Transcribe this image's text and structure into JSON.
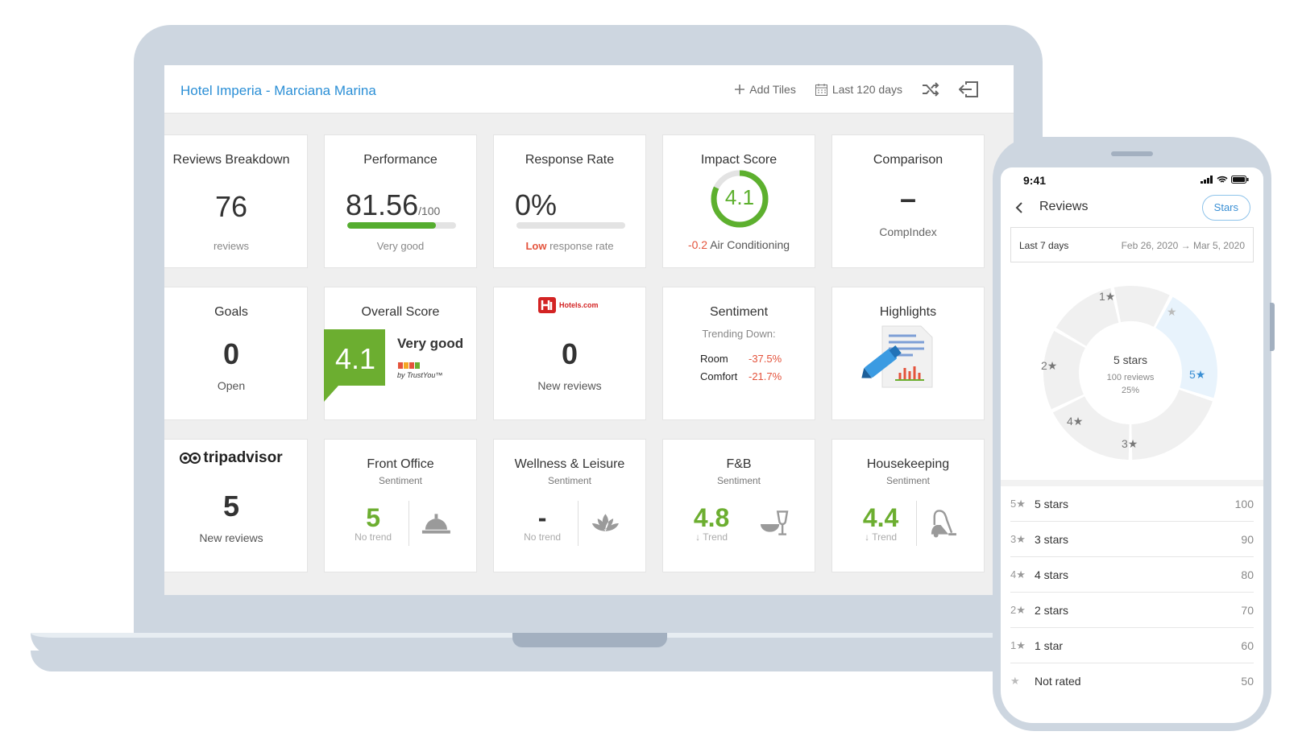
{
  "dashboard": {
    "hotel_title": "Hotel Imperia - Marciana Marina",
    "add_tiles": "Add Tiles",
    "date_range": "Last 120 days"
  },
  "tiles": {
    "reviews_breakdown": {
      "title": "Reviews Breakdown",
      "value": "76",
      "caption": "reviews"
    },
    "performance": {
      "title": "Performance",
      "value": "81.56",
      "suffix": "/100",
      "caption": "Very good",
      "progress": 0.8156
    },
    "response_rate": {
      "title": "Response Rate",
      "value": "0%",
      "caption_prefix": "Low",
      "caption": "response rate",
      "progress": 0
    },
    "impact_score": {
      "title": "Impact Score",
      "value": "4.1",
      "delta": "-0.2",
      "topic": "Air Conditioning",
      "ring": 0.82
    },
    "comparison": {
      "title": "Comparison",
      "value": "–",
      "caption": "CompIndex"
    },
    "goals": {
      "title": "Goals",
      "value": "0",
      "caption": "Open"
    },
    "overall_score": {
      "title": "Overall Score",
      "value": "4.1",
      "label": "Very good",
      "brand": "by TrustYou™"
    },
    "hotels_com": {
      "logo": "Hotels.com",
      "value": "0",
      "caption": "New reviews"
    },
    "sentiment": {
      "title": "Sentiment",
      "subtitle": "Trending Down:",
      "rows": [
        {
          "label": "Room",
          "value": "-37.5%"
        },
        {
          "label": "Comfort",
          "value": "-21.7%"
        }
      ]
    },
    "highlights": {
      "title": "Highlights"
    },
    "tripadvisor": {
      "logo": "tripadvisor",
      "value": "5",
      "caption": "New reviews"
    },
    "front_office": {
      "title": "Front Office",
      "subtitle": "Sentiment",
      "value": "5",
      "trend": "No trend"
    },
    "wellness": {
      "title": "Wellness & Leisure",
      "subtitle": "Sentiment",
      "value": "-",
      "trend": "No trend"
    },
    "fnb": {
      "title": "F&B",
      "subtitle": "Sentiment",
      "value": "4.8",
      "trend": "Trend"
    },
    "housekeeping": {
      "title": "Housekeeping",
      "subtitle": "Sentiment",
      "value": "4.4",
      "trend": "Trend"
    }
  },
  "phone": {
    "time": "9:41",
    "title": "Reviews",
    "stars_button": "Stars",
    "period": "Last 7 days",
    "period_range": "Feb 26, 2020 → Mar 5, 2020",
    "donut": {
      "center_title": "5 stars",
      "center_count": "100 reviews",
      "center_pct": "25%",
      "labels": {
        "one": "1★",
        "not_rated": "★",
        "five": "5★",
        "three": "3★",
        "four": "4★",
        "two": "2★"
      }
    },
    "ratings": [
      {
        "key": "5★",
        "label": "5 stars",
        "count": "100"
      },
      {
        "key": "3★",
        "label": "3 stars",
        "count": "90"
      },
      {
        "key": "4★",
        "label": "4 stars",
        "count": "80"
      },
      {
        "key": "2★",
        "label": "2 stars",
        "count": "70"
      },
      {
        "key": "1★",
        "label": "1 star",
        "count": "60"
      },
      {
        "key": "★",
        "label": "Not rated",
        "count": "50"
      }
    ]
  },
  "colors": {
    "accent": "#2b8fd6",
    "good": "#6cae30",
    "bad": "#e4533c",
    "device": "#cdd6e0"
  }
}
